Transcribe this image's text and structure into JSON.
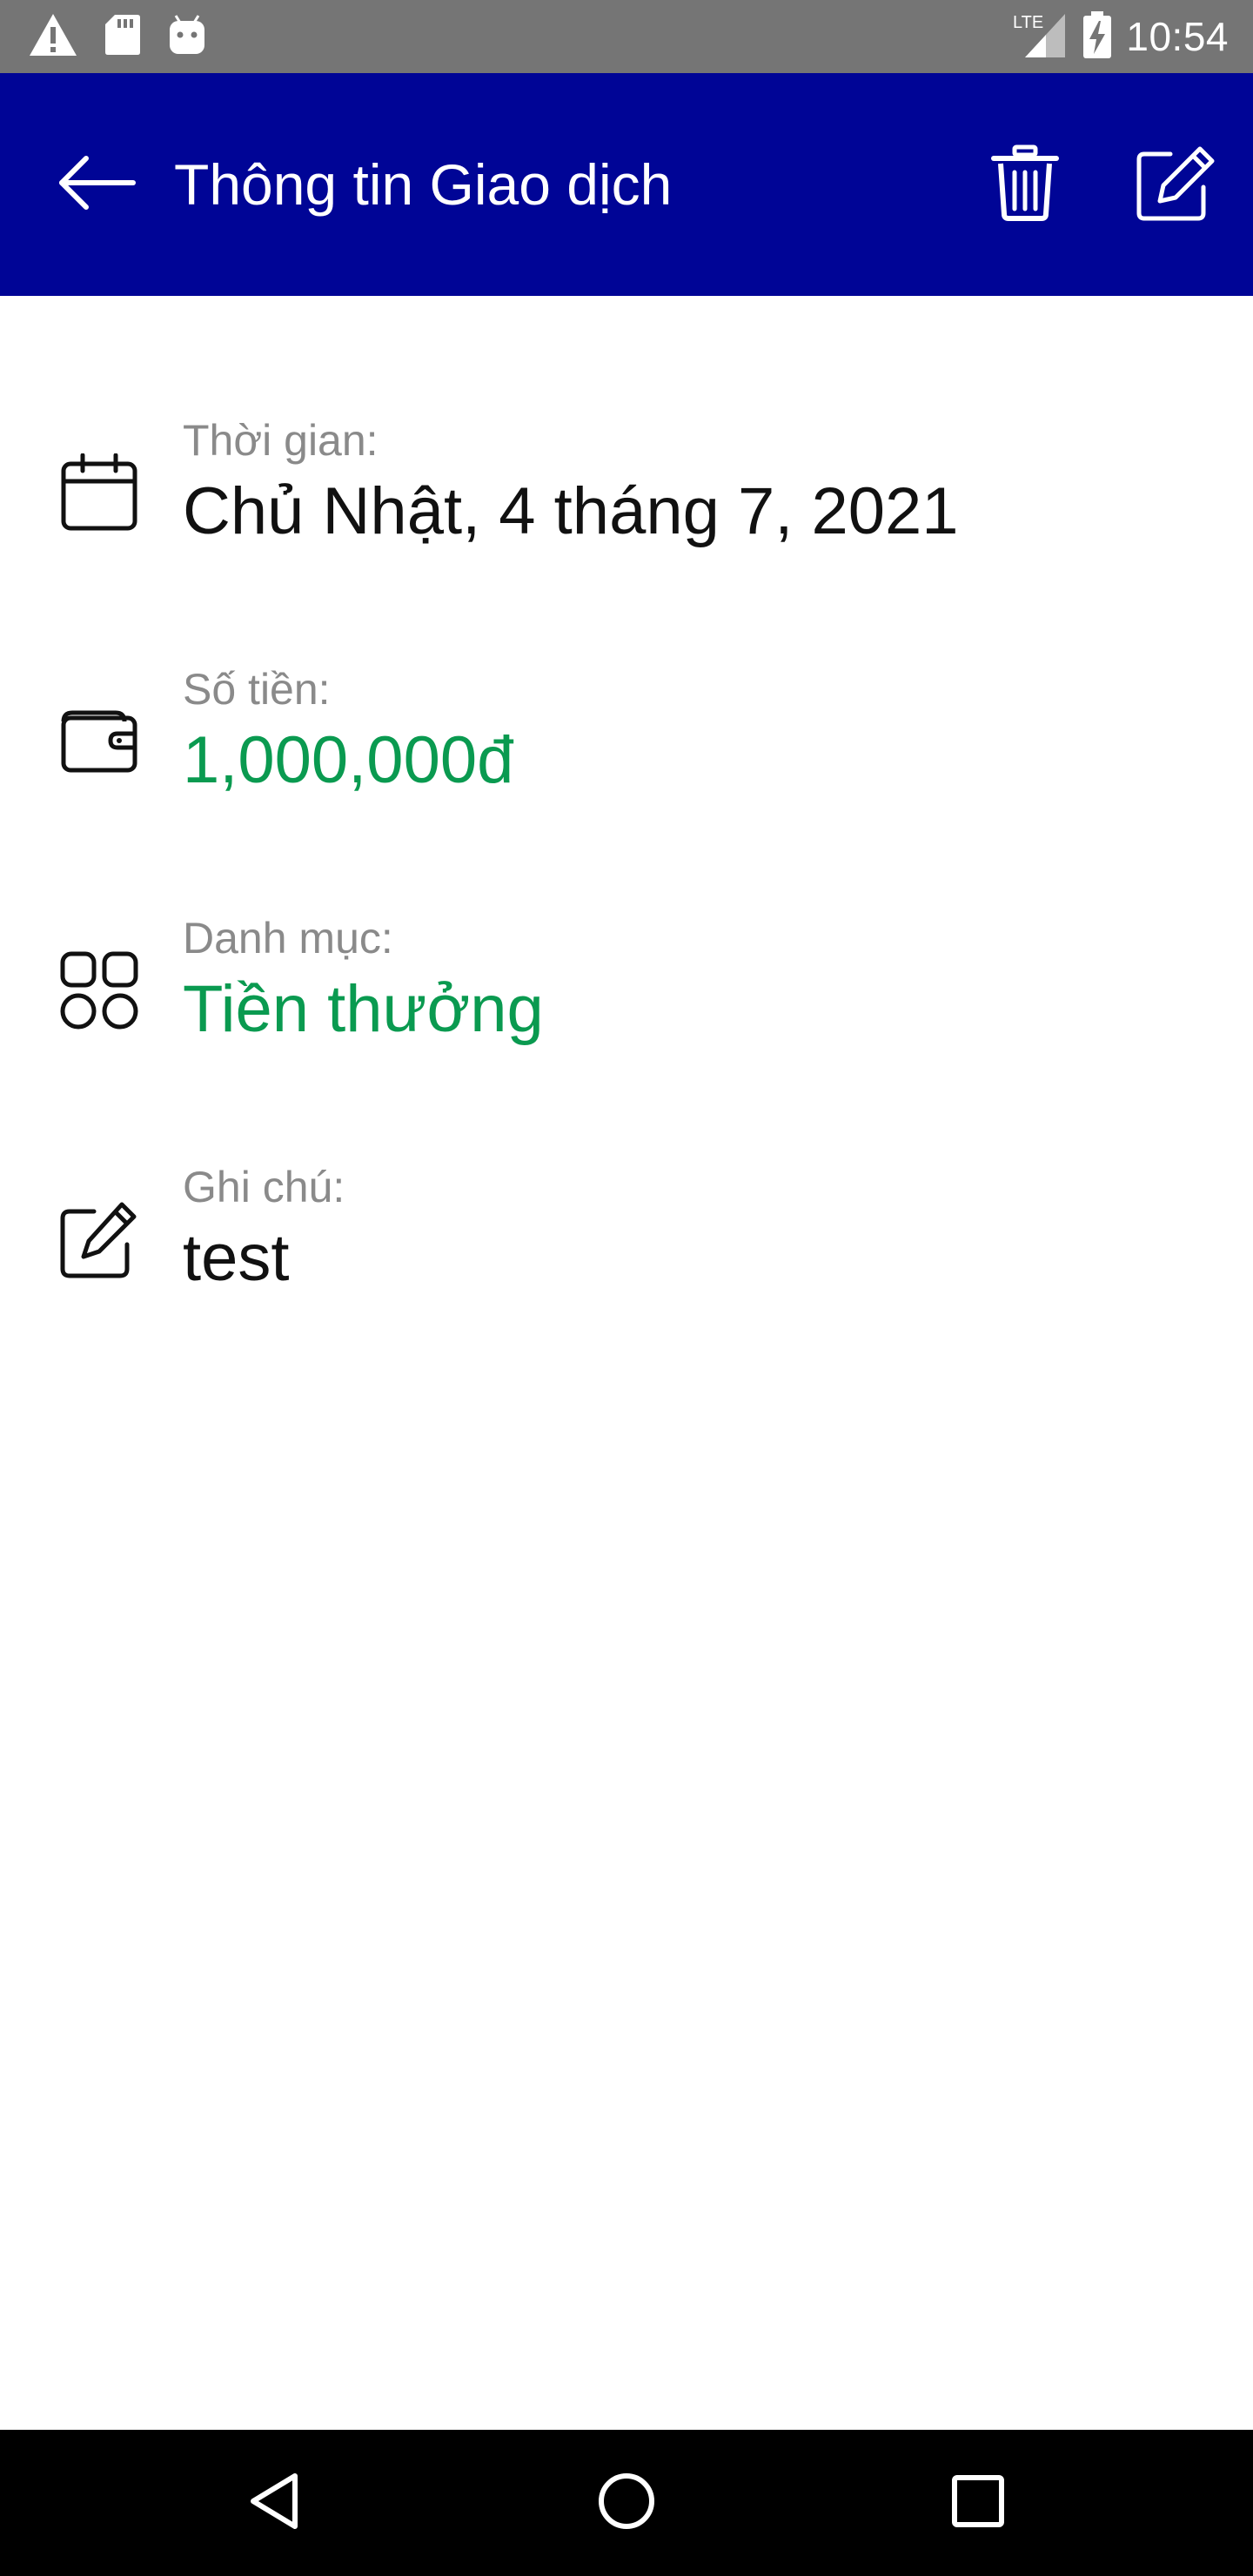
{
  "status_bar": {
    "time": "10:54",
    "network_label": "LTE",
    "icons": [
      "warning-icon",
      "sd-card-icon",
      "android-icon",
      "signal-icon",
      "battery-charging-icon"
    ]
  },
  "app_bar": {
    "title": "Thông tin Giao dịch",
    "background_color": "#000596",
    "icons": [
      "back-arrow-icon",
      "trash-icon",
      "edit-icon"
    ]
  },
  "details": [
    {
      "icon": "calendar-icon",
      "label": "Thời gian:",
      "value": "Chủ Nhật, 4 tháng 7, 2021",
      "value_color": "#111111"
    },
    {
      "icon": "wallet-icon",
      "label": "Số tiền:",
      "value": "1,000,000đ",
      "value_color": "#0a9a50"
    },
    {
      "icon": "category-grid-icon",
      "label": "Danh mục:",
      "value": "Tiền thưởng",
      "value_color": "#0a9a50"
    },
    {
      "icon": "note-edit-icon",
      "label": "Ghi chú:",
      "value": "test",
      "value_color": "#111111"
    }
  ],
  "nav_bar": {
    "icons": [
      "nav-back-icon",
      "nav-home-icon",
      "nav-recents-icon"
    ]
  }
}
